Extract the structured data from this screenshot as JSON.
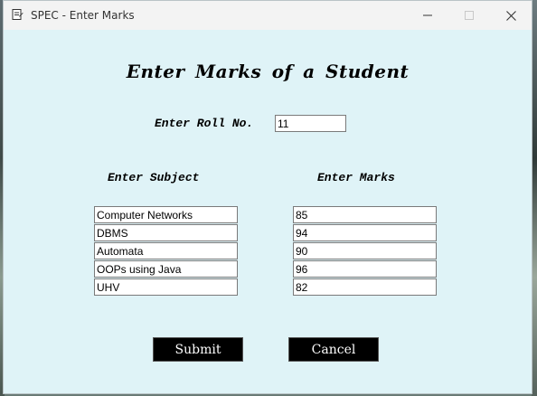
{
  "window": {
    "title": "SPEC - Enter Marks",
    "icon": "notepad-icon",
    "controls": {
      "minimize": "—",
      "maximize": "☐",
      "close": "✕"
    }
  },
  "form": {
    "heading": "Enter Marks of a Student",
    "roll_label": "Enter Roll No.",
    "roll_value": "11",
    "subject_header": "Enter Subject",
    "marks_header": "Enter Marks",
    "rows": [
      {
        "subject": "Computer Networks",
        "marks": "85"
      },
      {
        "subject": "DBMS",
        "marks": "94"
      },
      {
        "subject": "Automata",
        "marks": "90"
      },
      {
        "subject": "OOPs using Java",
        "marks": "96"
      },
      {
        "subject": "UHV",
        "marks": "82"
      }
    ],
    "submit_label": "Submit",
    "cancel_label": "Cancel"
  },
  "colors": {
    "window_bg": "#dff3f7",
    "titlebar_bg": "#f3f3f3",
    "button_bg": "#000000",
    "button_text": "#ffffff"
  }
}
